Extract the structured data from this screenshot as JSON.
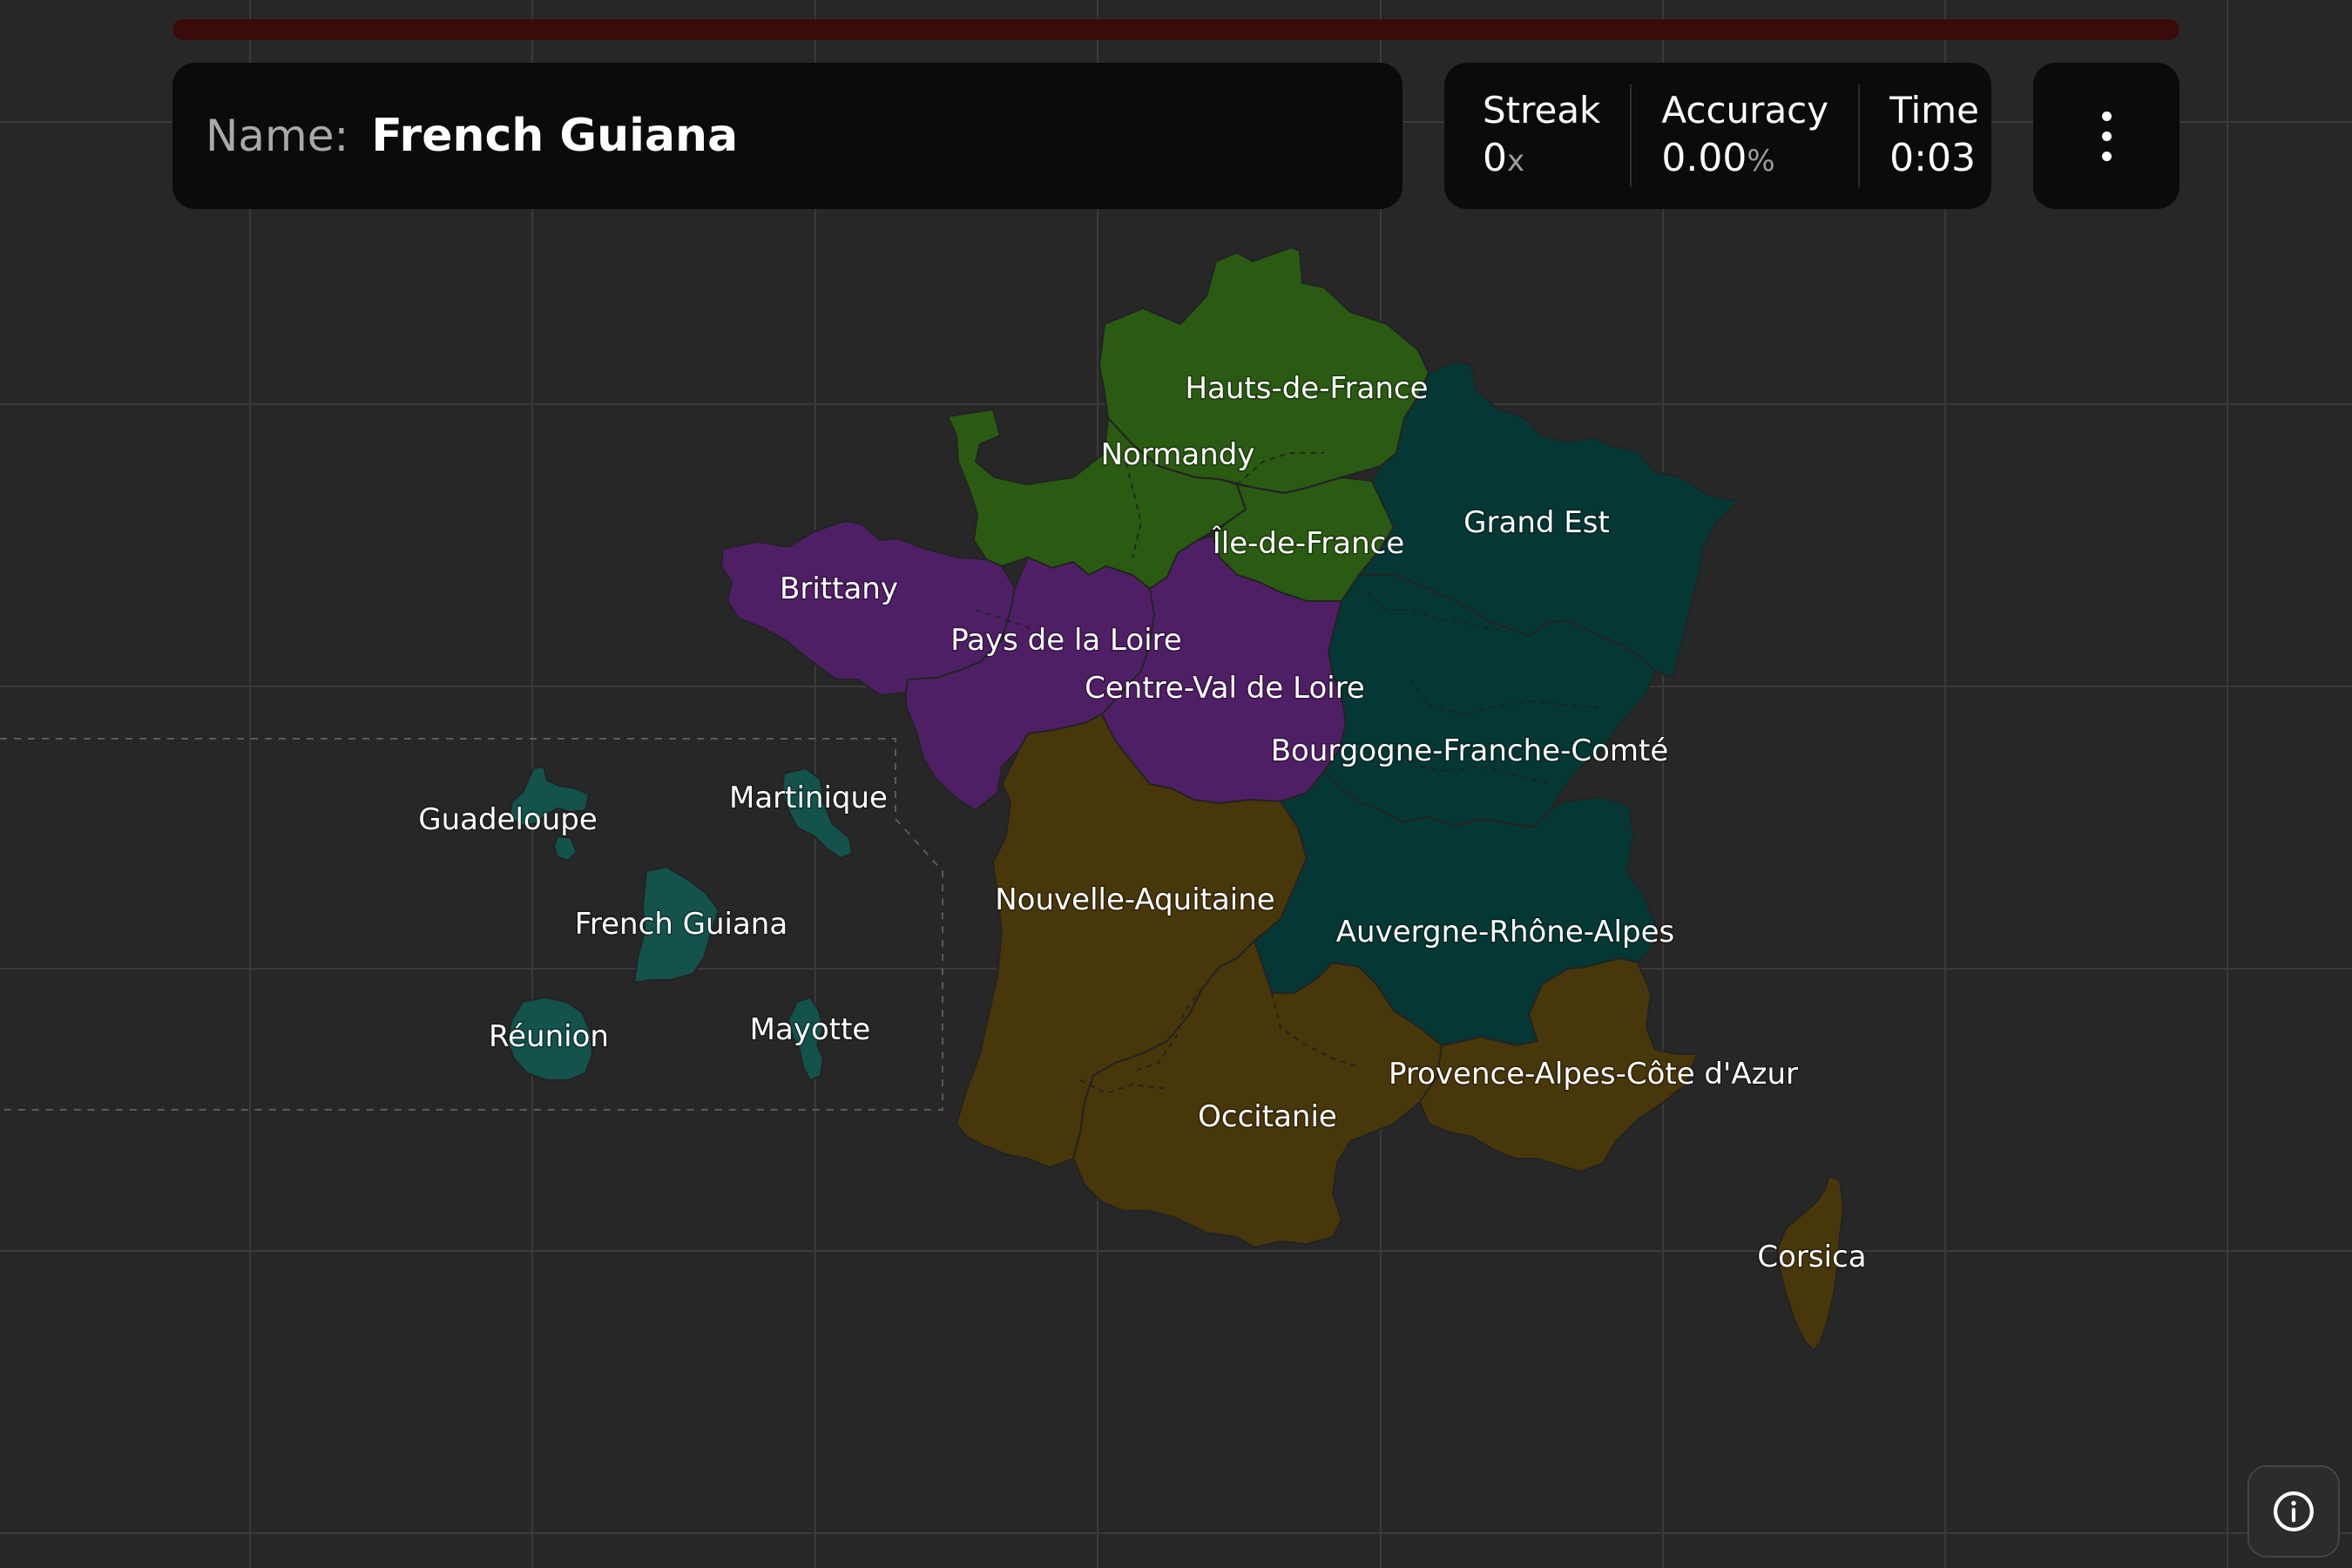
{
  "progress": {
    "fraction": 0.0
  },
  "prompt": {
    "label": "Name:",
    "value": "French Guiana"
  },
  "stats": {
    "streak": {
      "label": "Streak",
      "value": "0",
      "unit": "x"
    },
    "accuracy": {
      "label": "Accuracy",
      "value": "0.00",
      "unit": "%"
    },
    "time": {
      "label": "Time",
      "value": "0:03"
    }
  },
  "menu": {
    "icon": "more-vertical-icon"
  },
  "info": {
    "icon": "info-icon"
  },
  "regions": {
    "hauts_de_france": {
      "name": "Hauts-de-France",
      "color": "#2b5a13"
    },
    "normandy": {
      "name": "Normandy",
      "color": "#2b5a13"
    },
    "ile_de_france": {
      "name": "Île-de-France",
      "color": "#2b5a13"
    },
    "grand_est": {
      "name": "Grand Est",
      "color": "#053834"
    },
    "brittany": {
      "name": "Brittany",
      "color": "#4f1f66"
    },
    "pays_de_la_loire": {
      "name": "Pays de la Loire",
      "color": "#4f1f66"
    },
    "centre_val_de_loire": {
      "name": "Centre-Val de Loire",
      "color": "#4f1f66"
    },
    "bourgogne_franche_comte": {
      "name": "Bourgogne-Franche-Comté",
      "color": "#053834"
    },
    "nouvelle_aquitaine": {
      "name": "Nouvelle-Aquitaine",
      "color": "#48370a"
    },
    "auvergne_rhone_alpes": {
      "name": "Auvergne-Rhône-Alpes",
      "color": "#053834"
    },
    "occitanie": {
      "name": "Occitanie",
      "color": "#48370a"
    },
    "provence_alpes_cote_dazur": {
      "name": "Provence-Alpes-Côte d'Azur",
      "color": "#48370a"
    },
    "corsica": {
      "name": "Corsica",
      "color": "#48370a"
    },
    "guadeloupe": {
      "name": "Guadeloupe",
      "color": "#14524c"
    },
    "martinique": {
      "name": "Martinique",
      "color": "#14524c"
    },
    "french_guiana": {
      "name": "French Guiana",
      "color": "#14524c"
    },
    "reunion": {
      "name": "Réunion",
      "color": "#14524c"
    },
    "mayotte": {
      "name": "Mayotte",
      "color": "#14524c"
    }
  }
}
